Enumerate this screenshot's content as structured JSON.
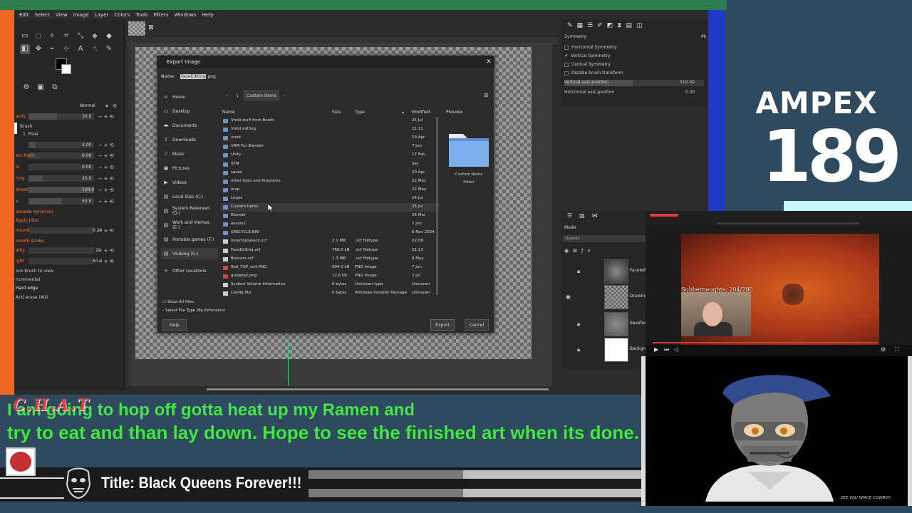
{
  "gimp": {
    "menu": [
      "Edit",
      "Select",
      "View",
      "Image",
      "Layer",
      "Colors",
      "Tools",
      "Filters",
      "Windows",
      "Help"
    ],
    "tool_options": {
      "mode_label": "Normal",
      "opacity_label": "acity",
      "opacity_value": "30.0",
      "brush_label": "Brush",
      "brush_name": "1. Pixel",
      "size_value": "3.00",
      "aspect_label": "ect Ratio",
      "aspect_value": "0.00",
      "angle_label": "le",
      "angle_value": "0.00",
      "spacing_label": "cing",
      "spacing_value": "20.0",
      "hardness_label": "dness",
      "hardness_value": "100.0",
      "force_label": "e",
      "force_value": "50.0",
      "dynamics_label": "amable dynamics",
      "jitter_label": "Apply Jitter",
      "amount_label": "mount",
      "amount_value": "0.20",
      "smooth_label": "mooth stroke",
      "quality_label": "ality",
      "quality_value": "20",
      "weight_label": "ight",
      "weight_value": "50.0",
      "lock_brush_label": "ock brush to view",
      "incremental_label": "ncremental",
      "hard_edge_label": "Hard edge",
      "anti_erase_label": "Anti erase (Alt)"
    },
    "symmetry": {
      "title": "Symmetry",
      "corner_label": "Mi",
      "horizontal": "Horizontal Symmetry",
      "vertical": "Vertical Symmetry",
      "central": "Central Symmetry",
      "disable": "Disable brush transform",
      "vap_label": "Vertical axis position",
      "vap_value": "512.00",
      "hap_label": "Horizontal axis position",
      "hap_value": "0.00"
    },
    "layers": {
      "mode": "Mode",
      "opacity": "Opacity",
      "items": [
        "Facewif",
        "Drawing",
        "baseface",
        "Backgro"
      ]
    }
  },
  "export_dialog": {
    "title": "Export Image",
    "name_label": "Name:",
    "filename_selected": "FaceEditing",
    "filename_ext": ".png",
    "breadcrumb": "Custom Items",
    "places": [
      "Home",
      "Desktop",
      "Documents",
      "Downloads",
      "Music",
      "Pictures",
      "Videos",
      "Local Disk (C:)",
      "System Reserved (D:)",
      "Work and Memes (E:)",
      "Portable games (F:)",
      "Vtubing (G:)",
      "Other Locations"
    ],
    "columns": {
      "name": "Name",
      "size": "Size",
      "type": "Type",
      "modified": "Modified"
    },
    "files": [
      {
        "name": "Vroid stuff from Booth",
        "size": "",
        "type": "",
        "modified": "25 Jul",
        "kind": "folder"
      },
      {
        "name": "Vroid editing",
        "size": "",
        "type": "",
        "modified": "21:11",
        "kind": "folder"
      },
      {
        "name": "vroid",
        "size": "",
        "type": "",
        "modified": "19 Apr",
        "kind": "folder"
      },
      {
        "name": "VRM For Blender",
        "size": "",
        "type": "",
        "modified": "7 Jun",
        "kind": "folder"
      },
      {
        "name": "Unity",
        "size": "",
        "type": "",
        "modified": "17 Feb",
        "kind": "folder"
      },
      {
        "name": "SFM",
        "size": "",
        "type": "",
        "modified": "Sat",
        "kind": "folder"
      },
      {
        "name": "saves",
        "size": "",
        "type": "",
        "modified": "20 Apr",
        "kind": "folder"
      },
      {
        "name": "other tools and Programs",
        "size": "",
        "type": "",
        "modified": "22 May",
        "kind": "folder"
      },
      {
        "name": "mvp",
        "size": "",
        "type": "",
        "modified": "22 May",
        "kind": "folder"
      },
      {
        "name": "Logos",
        "size": "",
        "type": "",
        "modified": "24 Jul",
        "kind": "folder"
      },
      {
        "name": "Custom Items",
        "size": "",
        "type": "",
        "modified": "25 Jul",
        "kind": "folder"
      },
      {
        "name": "Blender",
        "size": "",
        "type": "",
        "modified": "24 Mar",
        "kind": "folder"
      },
      {
        "name": "assets2",
        "size": "",
        "type": "",
        "modified": "7 Jun",
        "kind": "folder"
      },
      {
        "name": "$RECYCLE.BIN",
        "size": "",
        "type": "",
        "modified": "6 Nov 2024",
        "kind": "folder"
      },
      {
        "name": "Innertoplayer2.xcf",
        "size": "2.1 MB",
        "type": ".xcf filetype",
        "modified": "02:08",
        "kind": "file"
      },
      {
        "name": "FaceEditing.xcf",
        "size": "766.0 kB",
        "type": ".xcf filetype",
        "modified": "21:13",
        "kind": "file"
      },
      {
        "name": "Boxcers.xcf",
        "size": "1.3 MB",
        "type": ".xcf filetype",
        "modified": "9 May",
        "kind": "file"
      },
      {
        "name": "Red_TOP_suit.PNG",
        "size": "894.0 kB",
        "type": "PNG Image",
        "modified": "7 Jun",
        "kind": "png"
      },
      {
        "name": "guidetail.png",
        "size": "12.6 kB",
        "type": "PNG Image",
        "modified": "3 Jul",
        "kind": "png"
      },
      {
        "name": "System Volume Information",
        "size": "0 bytes",
        "type": "Unknown type",
        "modified": "Unknown",
        "kind": "file"
      },
      {
        "name": "Config.Msi",
        "size": "0 bytes",
        "type": "Windows Installer Package",
        "modified": "Unknown",
        "kind": "file"
      }
    ],
    "preview_label": "Preview",
    "preview_name": "Custom Items",
    "preview_type": "Folder",
    "show_all": "Show All Files",
    "select_type": "Select File Type (By Extension)",
    "help": "Help",
    "export": "Export",
    "cancel": "Cancel"
  },
  "overlay": {
    "ampex_title": "AMPEX",
    "ampex_number": "189",
    "chat_logo": "C.H.A.T",
    "chat_line1": "I am going to hop off gotta heat up my Ramen and",
    "chat_line2": "try to eat and than lay down. Hope to see the finished art when its done.",
    "title": "Title: Black Queens Forever!!!",
    "stream_counter": "Subbernaughts: 204/200",
    "see_you": "SEE YOU SPACE COWBOY"
  },
  "colors": {
    "gimp_bg": "#2b2b2b",
    "accent_orange": "#f06722",
    "chat_green": "#44e44a",
    "stream_blue": "#1f3cc9",
    "overlay_bg": "#2f4a5e"
  }
}
